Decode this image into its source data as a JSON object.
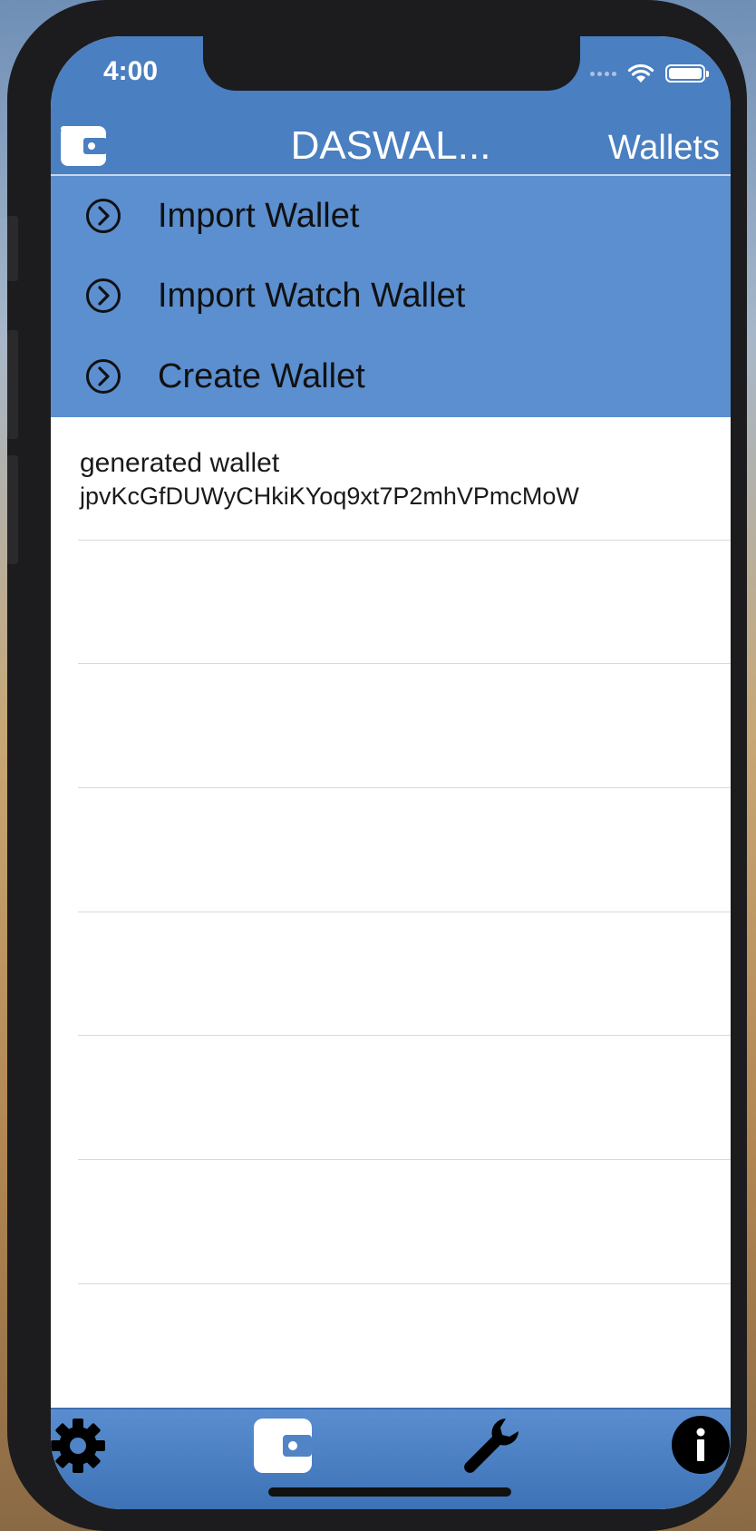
{
  "status_bar": {
    "time": "4:00"
  },
  "nav": {
    "title": "DASWAL...",
    "right_button": "Wallets"
  },
  "menu": {
    "items": [
      {
        "label": "Import Wallet"
      },
      {
        "label": "Import Watch Wallet"
      },
      {
        "label": "Create Wallet"
      }
    ]
  },
  "wallets": [
    {
      "name": "generated wallet",
      "address": "jpvKcGfDUWyCHkiKYoq9xt7P2mhVPmcMoW"
    }
  ],
  "tabbar": {
    "tabs": [
      {
        "icon": "gear-icon"
      },
      {
        "icon": "wallet-icon"
      },
      {
        "icon": "wrench-icon"
      },
      {
        "icon": "info-icon"
      }
    ]
  },
  "colors": {
    "header": "#4a7fc1",
    "menu": "#5b8fd0",
    "tabbar": "#4a7fc1"
  }
}
